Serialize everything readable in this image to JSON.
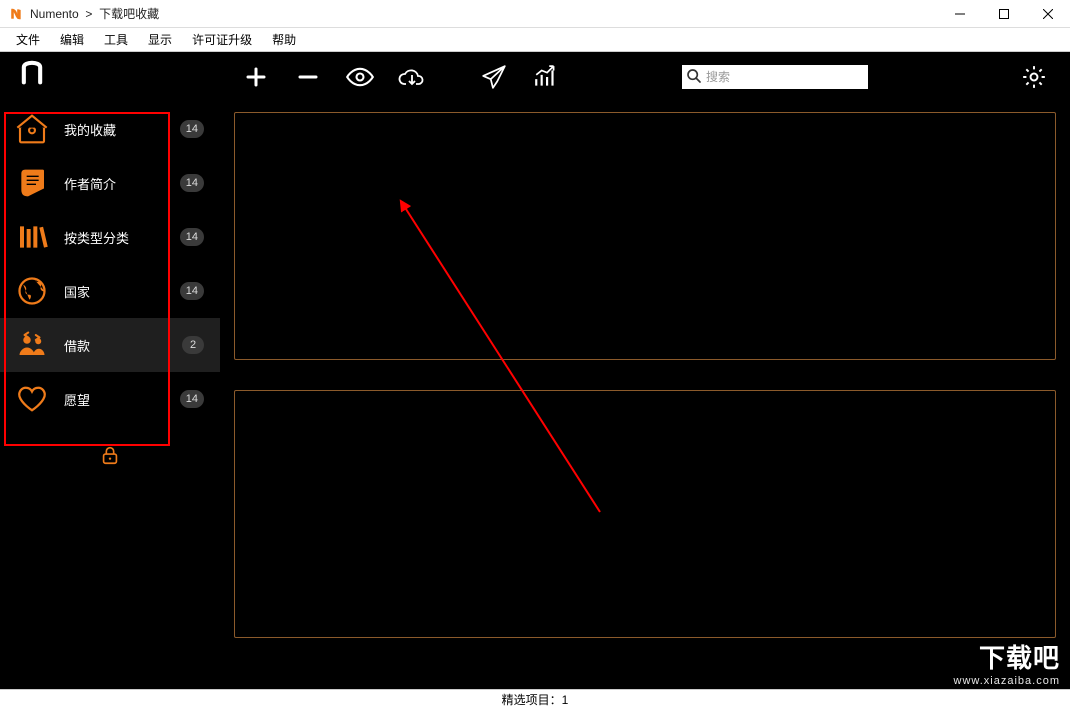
{
  "titlebar": {
    "app_name": "Numento",
    "separator": ">",
    "document": "下载吧收藏"
  },
  "menubar": {
    "items": [
      "文件",
      "编辑",
      "工具",
      "显示",
      "许可证升级",
      "帮助"
    ]
  },
  "sidebar": {
    "items": [
      {
        "label": "我的收藏",
        "badge": "14",
        "icon": "home"
      },
      {
        "label": "作者简介",
        "badge": "14",
        "icon": "author"
      },
      {
        "label": "按类型分类",
        "badge": "14",
        "icon": "library"
      },
      {
        "label": "国家",
        "badge": "14",
        "icon": "globe"
      },
      {
        "label": "借款",
        "badge": "2",
        "icon": "loan",
        "active": true
      },
      {
        "label": "愿望",
        "badge": "14",
        "icon": "heart"
      }
    ]
  },
  "toolbar": {
    "search_placeholder": "搜索"
  },
  "statusbar": {
    "text": "精选项目：1"
  },
  "watermark": {
    "big": "下载吧",
    "small": "www.xiazaiba.com"
  }
}
